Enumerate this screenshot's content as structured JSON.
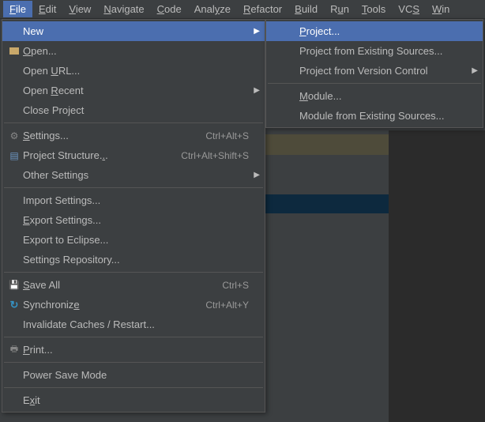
{
  "menubar": [
    {
      "label": "File",
      "u": 0,
      "active": true
    },
    {
      "label": "Edit",
      "u": 0
    },
    {
      "label": "View",
      "u": 0
    },
    {
      "label": "Navigate",
      "u": 0
    },
    {
      "label": "Code",
      "u": 0
    },
    {
      "label": "Analyze",
      "u": 4
    },
    {
      "label": "Refactor",
      "u": 0
    },
    {
      "label": "Build",
      "u": 0
    },
    {
      "label": "Run",
      "u": 1
    },
    {
      "label": "Tools",
      "u": 0
    },
    {
      "label": "VCS",
      "u": 2
    },
    {
      "label": "Win",
      "u": 0
    }
  ],
  "fileMenu": [
    {
      "type": "item",
      "label": "New",
      "highlight": true,
      "submenu": true
    },
    {
      "type": "item",
      "label": "Open...",
      "u": 0,
      "icon": "folder"
    },
    {
      "type": "item",
      "label": "Open URL...",
      "u": 5
    },
    {
      "type": "item",
      "label": "Open Recent",
      "u": 5,
      "submenu": true
    },
    {
      "type": "item",
      "label": "Close Project"
    },
    {
      "type": "sep"
    },
    {
      "type": "item",
      "label": "Settings...",
      "u": 0,
      "icon": "gear",
      "shortcut": "Ctrl+Alt+S"
    },
    {
      "type": "item",
      "label": "Project Structure...",
      "u": 18,
      "icon": "structure",
      "shortcut": "Ctrl+Alt+Shift+S"
    },
    {
      "type": "item",
      "label": "Other Settings",
      "submenu": true
    },
    {
      "type": "sep"
    },
    {
      "type": "item",
      "label": "Import Settings..."
    },
    {
      "type": "item",
      "label": "Export Settings...",
      "u": 0
    },
    {
      "type": "item",
      "label": "Export to Eclipse..."
    },
    {
      "type": "item",
      "label": "Settings Repository..."
    },
    {
      "type": "sep"
    },
    {
      "type": "item",
      "label": "Save All",
      "u": 0,
      "icon": "disk",
      "shortcut": "Ctrl+S"
    },
    {
      "type": "item",
      "label": "Synchronize",
      "u": 10,
      "icon": "sync",
      "shortcut": "Ctrl+Alt+Y"
    },
    {
      "type": "item",
      "label": "Invalidate Caches / Restart..."
    },
    {
      "type": "sep"
    },
    {
      "type": "item",
      "label": "Print...",
      "u": 0,
      "icon": "print"
    },
    {
      "type": "sep"
    },
    {
      "type": "item",
      "label": "Power Save Mode"
    },
    {
      "type": "sep"
    },
    {
      "type": "item",
      "label": "Exit",
      "u": 1
    }
  ],
  "newSubmenu": [
    {
      "type": "item",
      "label": "Project...",
      "u": 0,
      "highlight": true
    },
    {
      "type": "item",
      "label": "Project from Existing Sources..."
    },
    {
      "type": "item",
      "label": "Project from Version Control",
      "submenu": true
    },
    {
      "type": "sep"
    },
    {
      "type": "item",
      "label": "Module...",
      "u": 0
    },
    {
      "type": "item",
      "label": "Module from Existing Sources..."
    }
  ]
}
